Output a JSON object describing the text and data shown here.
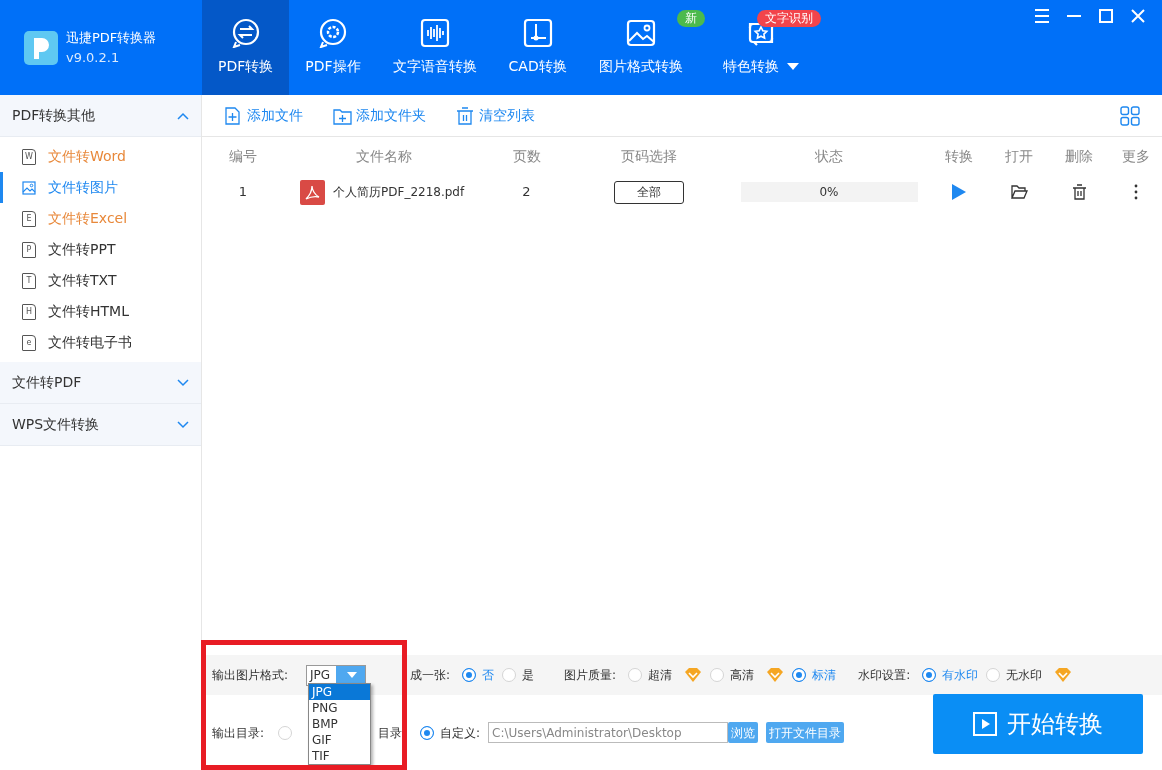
{
  "app": {
    "name": "迅捷PDF转换器",
    "version": "v9.0.2.1"
  },
  "nav_tabs": [
    {
      "label": "PDF转换",
      "kind": "convert",
      "selected": true
    },
    {
      "label": "PDF操作",
      "kind": "gear",
      "selected": false
    },
    {
      "label": "文字语音转换",
      "kind": "wave",
      "selected": false
    },
    {
      "label": "CAD转换",
      "kind": "cad",
      "selected": false
    },
    {
      "label": "图片格式转换",
      "kind": "image",
      "selected": false,
      "badge": {
        "text": "新",
        "color": "#4cba4c"
      }
    },
    {
      "label": "特色转换",
      "kind": "star",
      "selected": false,
      "badge": {
        "text": "文字识别",
        "color": "#f2444b"
      },
      "dropdown": true
    }
  ],
  "sidebar": [
    {
      "label": "PDF转换其他",
      "expanded": true,
      "items": [
        {
          "label": "文件转Word",
          "icon_text": "W",
          "selected": false,
          "color": "#e8883a"
        },
        {
          "label": "文件转图片",
          "kind": "image",
          "selected": true,
          "color": "#1e88f0"
        },
        {
          "label": "文件转Excel",
          "icon_text": "E",
          "selected": false,
          "color": "#e8883a"
        },
        {
          "label": "文件转PPT",
          "icon_text": "P",
          "selected": false,
          "color": "#333333"
        },
        {
          "label": "文件转TXT",
          "icon_text": "T",
          "selected": false,
          "color": "#333333"
        },
        {
          "label": "文件转HTML",
          "icon_text": "H",
          "selected": false,
          "color": "#333333"
        },
        {
          "label": "文件转电子书",
          "icon_text": "e",
          "selected": false,
          "color": "#333333"
        }
      ]
    },
    {
      "label": "文件转PDF",
      "expanded": false
    },
    {
      "label": "WPS文件转换",
      "expanded": false
    }
  ],
  "toolbar": [
    {
      "label": "添加文件",
      "kind": "file"
    },
    {
      "label": "添加文件夹",
      "kind": "folder"
    },
    {
      "label": "清空列表",
      "kind": "trash"
    }
  ],
  "table": {
    "columns": [
      "编号",
      "文件名称",
      "页数",
      "页码选择",
      "状态",
      "转换",
      "打开",
      "删除",
      "更多"
    ],
    "rows": [
      {
        "number": "1",
        "file_name": "个人简历PDF_2218.pdf",
        "pages": "2",
        "page_select": "全部",
        "status": "0%",
        "level": 0
      }
    ]
  },
  "settings": {
    "format": {
      "label": "输出图片格式:",
      "value": "JPG",
      "options": [
        {
          "label": "JPG",
          "selected": true
        },
        {
          "label": "PNG",
          "selected": false
        },
        {
          "label": "BMP",
          "selected": false
        },
        {
          "label": "GIF",
          "selected": false
        },
        {
          "label": "TIF",
          "selected": false
        }
      ]
    },
    "merge": {
      "label": "成一张:",
      "options": [
        {
          "label": "否",
          "selected": true
        },
        {
          "label": "是",
          "selected": false
        }
      ]
    },
    "quality": {
      "label": "图片质量:",
      "options": [
        {
          "label": "超清",
          "selected": false,
          "premium": true
        },
        {
          "label": "高清",
          "selected": false,
          "premium": true
        },
        {
          "label": "标清",
          "selected": true,
          "premium": false
        }
      ]
    },
    "watermark": {
      "label": "水印设置:",
      "options": [
        {
          "label": "有水印",
          "selected": true,
          "premium": false
        },
        {
          "label": "无水印",
          "selected": false,
          "premium": true
        }
      ]
    }
  },
  "output": {
    "label": "输出目录:",
    "options": [
      {
        "label": "目录",
        "selected": false
      },
      {
        "label": "自定义:",
        "selected": true
      }
    ],
    "path": "C:\\Users\\Administrator\\Desktop",
    "browse": "浏览",
    "open_dir": "打开文件目录"
  },
  "start_button": "开始转换"
}
